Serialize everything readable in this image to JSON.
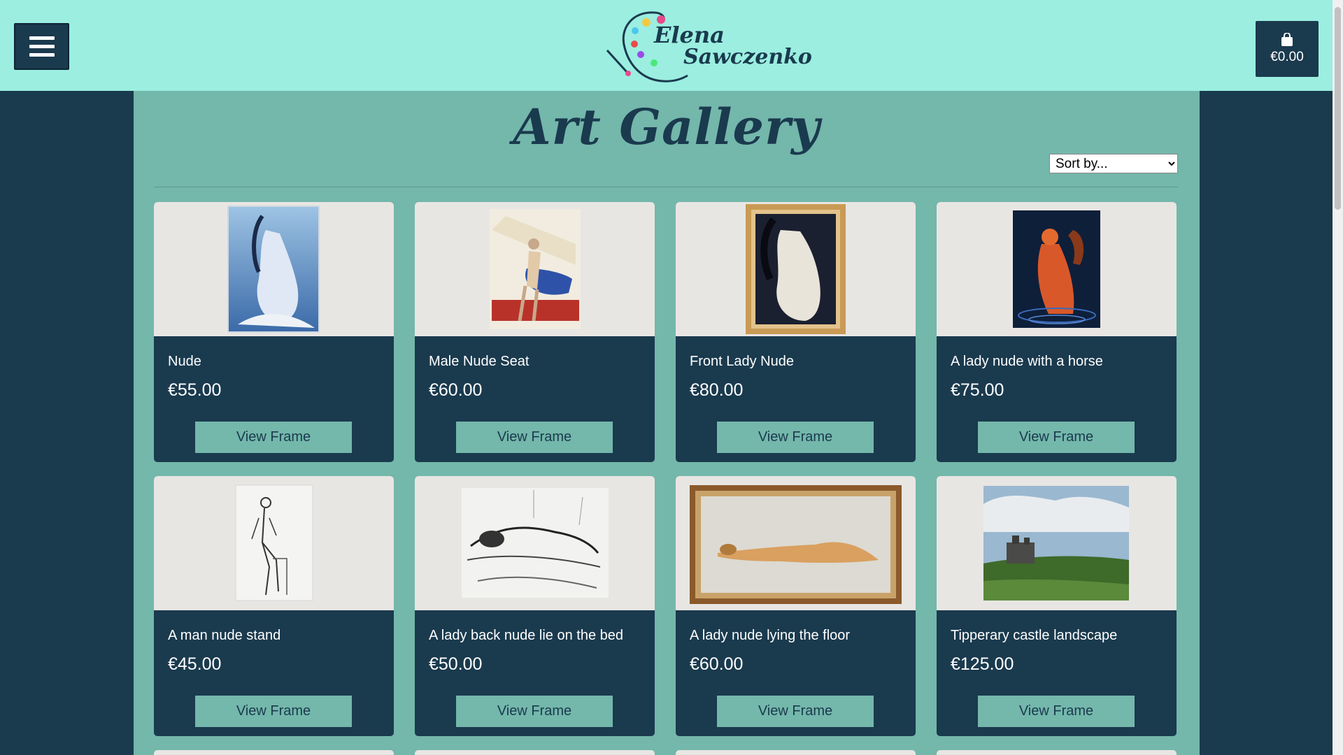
{
  "header": {
    "logo_line1": "Elena",
    "logo_line2": "Sawczenko",
    "cart_total": "€0.00"
  },
  "page": {
    "title": "Art Gallery",
    "sort_placeholder": "Sort by..."
  },
  "colors": {
    "header_bg": "#9beee0",
    "page_bg": "#1a3a4e",
    "content_bg": "#74b7ab",
    "card_bg": "#1a3a4e",
    "button_bg": "#74b7ab"
  },
  "products": [
    {
      "name": "Nude",
      "price": "€55.00",
      "button": "View Frame"
    },
    {
      "name": "Male Nude Seat",
      "price": "€60.00",
      "button": "View Frame"
    },
    {
      "name": "Front Lady Nude",
      "price": "€80.00",
      "button": "View Frame"
    },
    {
      "name": "A lady nude with a horse",
      "price": "€75.00",
      "button": "View Frame"
    },
    {
      "name": "A man nude stand",
      "price": "€45.00",
      "button": "View Frame"
    },
    {
      "name": "A lady back nude lie on the bed",
      "price": "€50.00",
      "button": "View Frame"
    },
    {
      "name": "A lady nude lying the floor",
      "price": "€60.00",
      "button": "View Frame"
    },
    {
      "name": "Tipperary castle landscape",
      "price": "€125.00",
      "button": "View Frame"
    }
  ]
}
